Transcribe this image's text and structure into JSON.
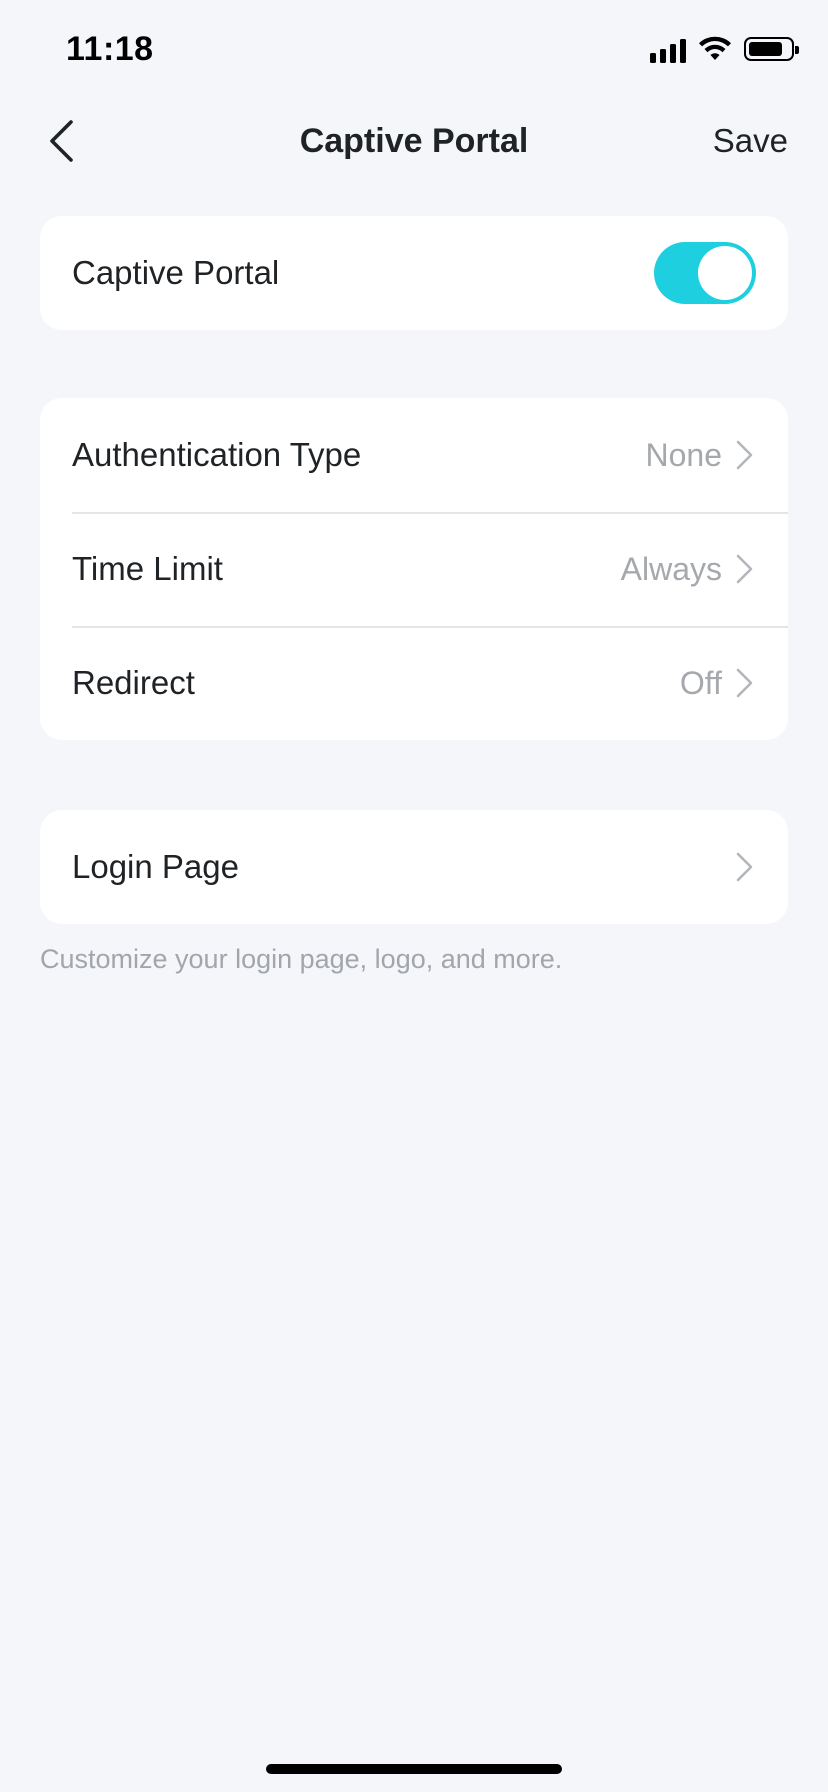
{
  "status_bar": {
    "time": "11:18",
    "icons": [
      "signal-icon",
      "wifi-icon",
      "battery-icon"
    ]
  },
  "nav": {
    "back_icon": "chevron-left-icon",
    "title": "Captive Portal",
    "save_label": "Save"
  },
  "toggle_card": {
    "label": "Captive Portal",
    "enabled": true,
    "accent_color": "#1ecfe0"
  },
  "settings": {
    "items": [
      {
        "label": "Authentication Type",
        "value": "None"
      },
      {
        "label": "Time Limit",
        "value": "Always"
      },
      {
        "label": "Redirect",
        "value": "Off"
      }
    ]
  },
  "login_card": {
    "label": "Login Page",
    "hint": "Customize your login page, logo, and more."
  }
}
